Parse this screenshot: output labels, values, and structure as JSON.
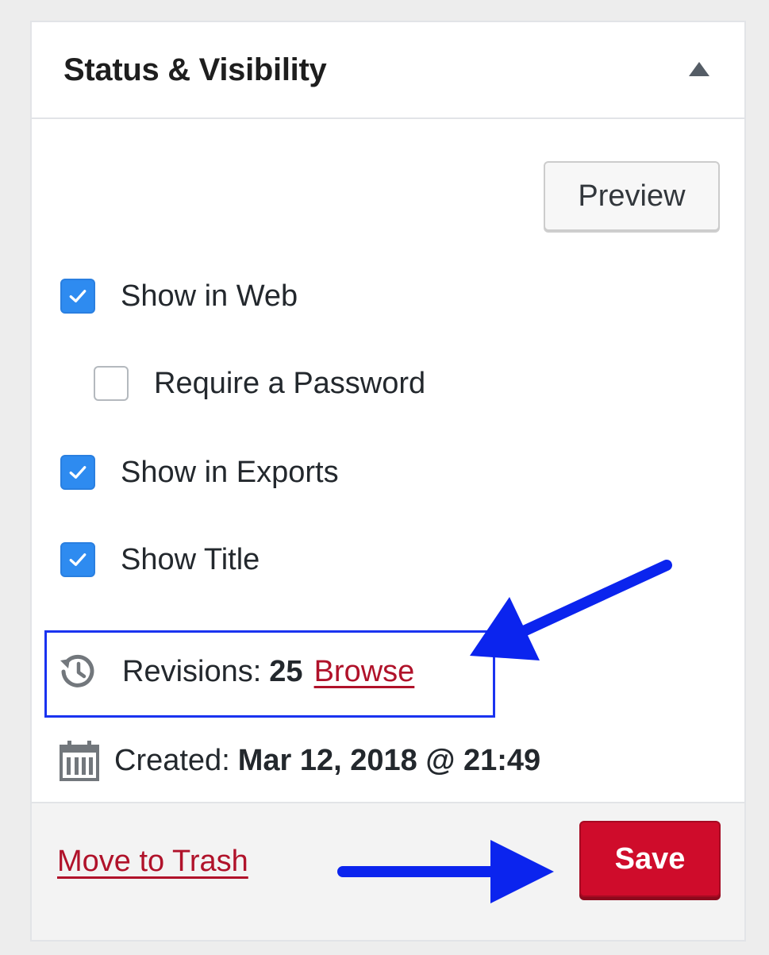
{
  "panel": {
    "title": "Status & Visibility",
    "collapse_icon": "triangle-up-icon"
  },
  "toolbar": {
    "preview_label": "Preview"
  },
  "options": [
    {
      "label": "Show in Web",
      "checked": true
    },
    {
      "label": "Require a Password",
      "checked": false
    },
    {
      "label": "Show in Exports",
      "checked": true
    },
    {
      "label": "Show Title",
      "checked": true
    }
  ],
  "revisions": {
    "icon": "history-icon",
    "label": "Revisions:",
    "count": "25",
    "browse_label": "Browse"
  },
  "created": {
    "icon": "calendar-icon",
    "label": "Created:",
    "value": "Mar 12, 2018 @ 21:49"
  },
  "footer": {
    "trash_label": "Move to Trash",
    "save_label": "Save"
  },
  "colors": {
    "accent_blue": "#2e8bf0",
    "danger_red": "#cf0c2b",
    "link_red": "#b0122a",
    "annotation_blue": "#1a33f0"
  }
}
